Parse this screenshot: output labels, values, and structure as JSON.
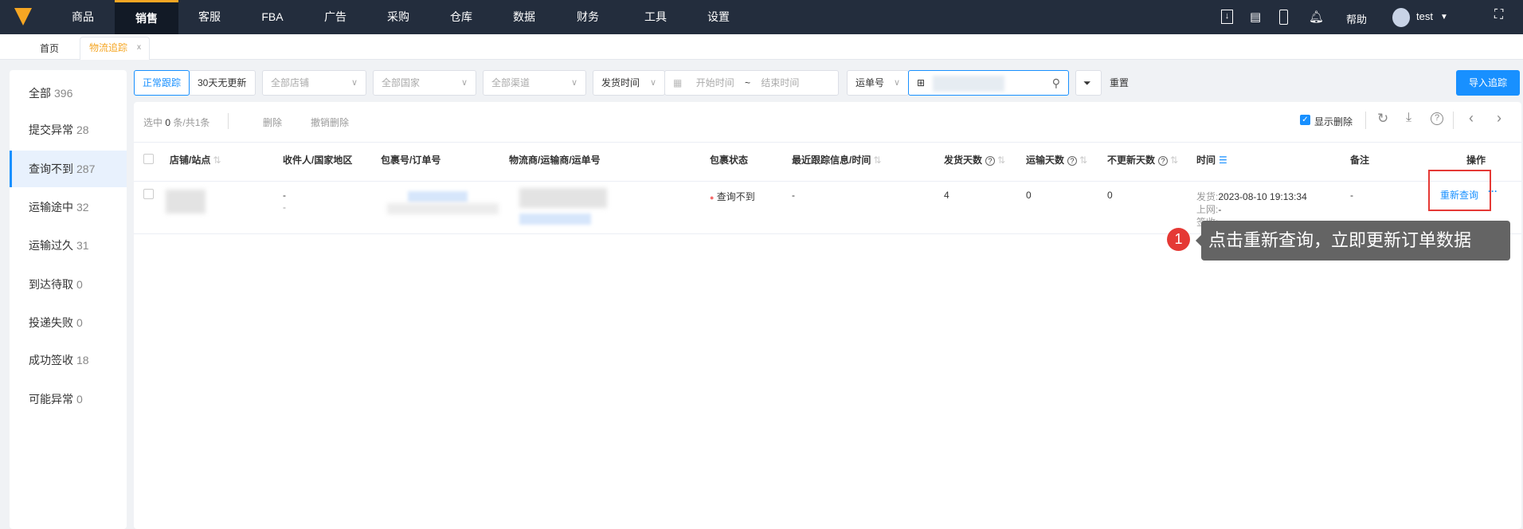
{
  "nav": {
    "items": [
      "商品",
      "销售",
      "客服",
      "FBA",
      "广告",
      "采购",
      "仓库",
      "数据",
      "财务",
      "工具",
      "设置"
    ],
    "active": "销售",
    "help": "帮助",
    "user": "test"
  },
  "tabs": {
    "home": "首页",
    "current": "物流追踪",
    "close": "x"
  },
  "sidebar": {
    "items": [
      {
        "label": "全部",
        "count": "396"
      },
      {
        "label": "提交异常",
        "count": "28"
      },
      {
        "label": "查询不到",
        "count": "287"
      },
      {
        "label": "运输途中",
        "count": "32"
      },
      {
        "label": "运输过久",
        "count": "31"
      },
      {
        "label": "到达待取",
        "count": "0"
      },
      {
        "label": "投递失败",
        "count": "0"
      },
      {
        "label": "成功签收",
        "count": "18"
      },
      {
        "label": "可能异常",
        "count": "0"
      }
    ],
    "active": "查询不到"
  },
  "filters": {
    "normal": "正常跟踪",
    "stale": "30天无更新",
    "store": "全部店铺",
    "country": "全部国家",
    "channel": "全部渠道",
    "time_type": "发货时间",
    "start": "开始时间",
    "tilde": "~",
    "end": "结束时间",
    "search_type": "运单号",
    "reset": "重置",
    "import": "导入追踪"
  },
  "toolbar": {
    "selected": "选中",
    "sel_count": "0",
    "sel_rest": "条/共1条",
    "delete": "删除",
    "undo_delete": "撤销删除",
    "show_deleted": "显示删除"
  },
  "table": {
    "headers": [
      "店铺/站点",
      "收件人/国家地区",
      "包裹号/订单号",
      "物流商/运输商/运单号",
      "包裹状态",
      "最近跟踪信息/时间",
      "发货天数",
      "运输天数",
      "不更新天数",
      "时间",
      "备注",
      "操作"
    ],
    "row": {
      "recipient": "-",
      "country": "-",
      "status": "查询不到",
      "latest": "-",
      "ship_days": "4",
      "transit_days": "0",
      "stale_days": "0",
      "ship_label": "发货:",
      "ship_time": "2023-08-10 19:13:34",
      "online_label": "上网:",
      "online_val": "-",
      "sign_label": "签收:",
      "sign_val": "-",
      "remark": "-",
      "action": "重新查询",
      "more": "···"
    }
  },
  "tooltip": {
    "step": "1",
    "text": "点击重新查询，立即更新订单数据"
  },
  "colors": {
    "accent": "#1890ff",
    "nav": "#232d3d",
    "highlight": "#e53935",
    "status_dot": "#f56c6c"
  }
}
